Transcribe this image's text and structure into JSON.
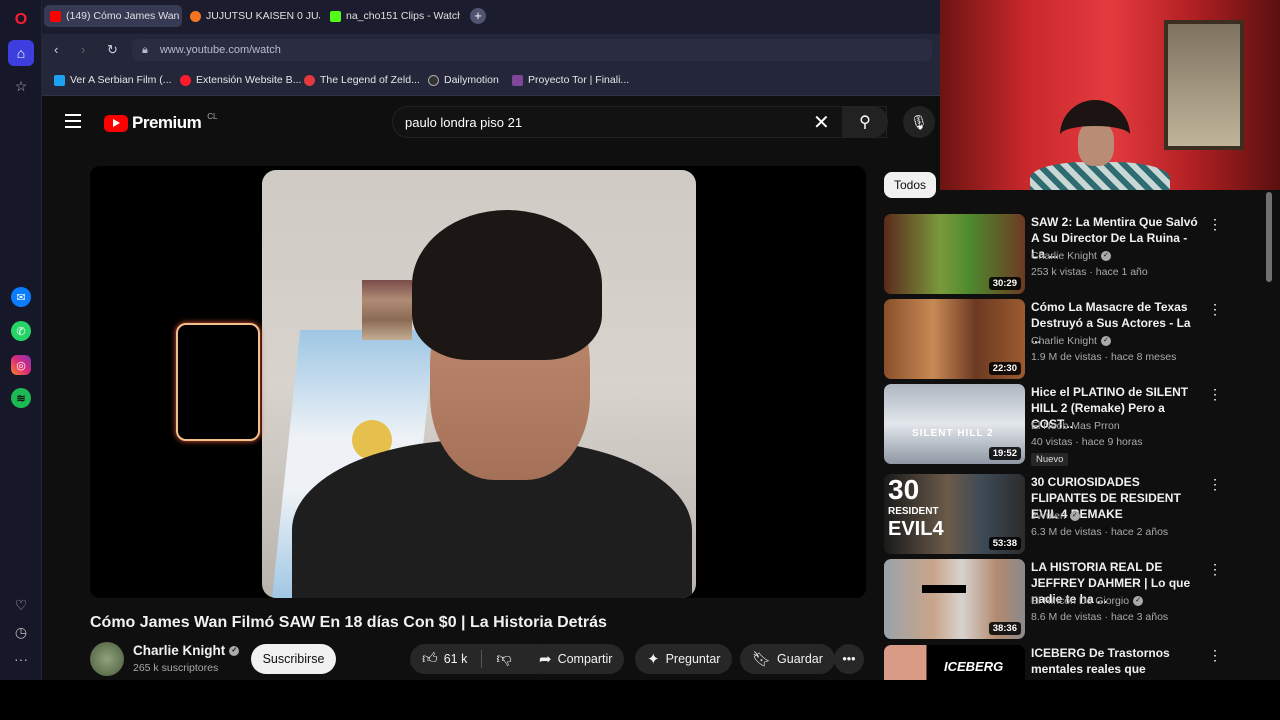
{
  "browser": {
    "tabs": [
      {
        "label": "(149) Cómo James Wan Fi",
        "active": true,
        "favicon_color": "#ff0000"
      },
      {
        "label": "JUJUTSU KAISEN 0 JUJUTS",
        "active": false,
        "favicon_color": "#f47521"
      },
      {
        "label": "na_cho151 Clips - Watch L",
        "active": false,
        "favicon_color": "#53fc18"
      }
    ],
    "url": "www.youtube.com/watch",
    "bookmarks": [
      {
        "label": "Ver A Serbian Film (...",
        "favicon_color": "#1da1f2"
      },
      {
        "label": "Extensión Website B...",
        "favicon_color": "#ff1b2d"
      },
      {
        "label": "The Legend of Zeld...",
        "favicon_color": "#e0393e"
      },
      {
        "label": "Dailymotion",
        "favicon_color": "#333333"
      },
      {
        "label": "Proyecto Tor | Finali...",
        "favicon_color": "#7e4798"
      }
    ]
  },
  "youtube": {
    "logo_text": "Premium",
    "country_code": "CL",
    "search_query": "paulo londra piso 21",
    "video": {
      "title": "Cómo James Wan Filmó SAW En 18 días Con $0 | La Historia Detrás",
      "channel": "Charlie Knight",
      "subscribers": "265 k suscriptores",
      "subscribe_label": "Suscribirse",
      "likes": "61 k",
      "share_label": "Compartir",
      "ask_label": "Preguntar",
      "save_label": "Guardar"
    },
    "filter_chip": "Todos",
    "recommendations": [
      {
        "title": "SAW 2: La Mentira Que Salvó A Su Director De La Ruina - La ...",
        "channel": "Charlie Knight",
        "verified": true,
        "meta": "253 k vistas · hace 1 año",
        "duration": "30:29",
        "badge": ""
      },
      {
        "title": "Cómo La Masacre de Texas Destruyó a Sus Actores - La ...",
        "channel": "Charlie Knight",
        "verified": true,
        "meta": "1.9 M de vistas · hace 8 meses",
        "duration": "22:30",
        "badge": ""
      },
      {
        "title": "Hice el PLATINO de SILENT HILL 2 (Remake) Pero a COST...",
        "channel": "El Noob Mas Prron",
        "verified": false,
        "meta": "40 vistas · hace 9 horas",
        "duration": "19:52",
        "badge": "Nuevo"
      },
      {
        "title": "30 CURIOSIDADES FLIPANTES DE RESIDENT EVIL 4 REMAKE",
        "channel": "JWulen",
        "verified": true,
        "meta": "6.3 M de vistas · hace 2 años",
        "duration": "53:38",
        "badge": ""
      },
      {
        "title": "LA HISTORIA REAL DE JEFFREY DAHMER | Lo que nadie te ha ...",
        "channel": "El Rincón De Giorgio",
        "verified": true,
        "meta": "8.6 M de vistas · hace 3 años",
        "duration": "38:36",
        "badge": ""
      },
      {
        "title": "ICEBERG De Trastornos mentales reales que destruyen...",
        "channel": "",
        "verified": false,
        "meta": "",
        "duration": "",
        "badge": ""
      }
    ]
  },
  "thumb_texts": {
    "silent_hill": "SILENT HILL 2",
    "re4_top": "30",
    "re4_mid": "RESIDENT",
    "re4_bot": "EVIL4",
    "iceberg": "ICEBERG"
  }
}
